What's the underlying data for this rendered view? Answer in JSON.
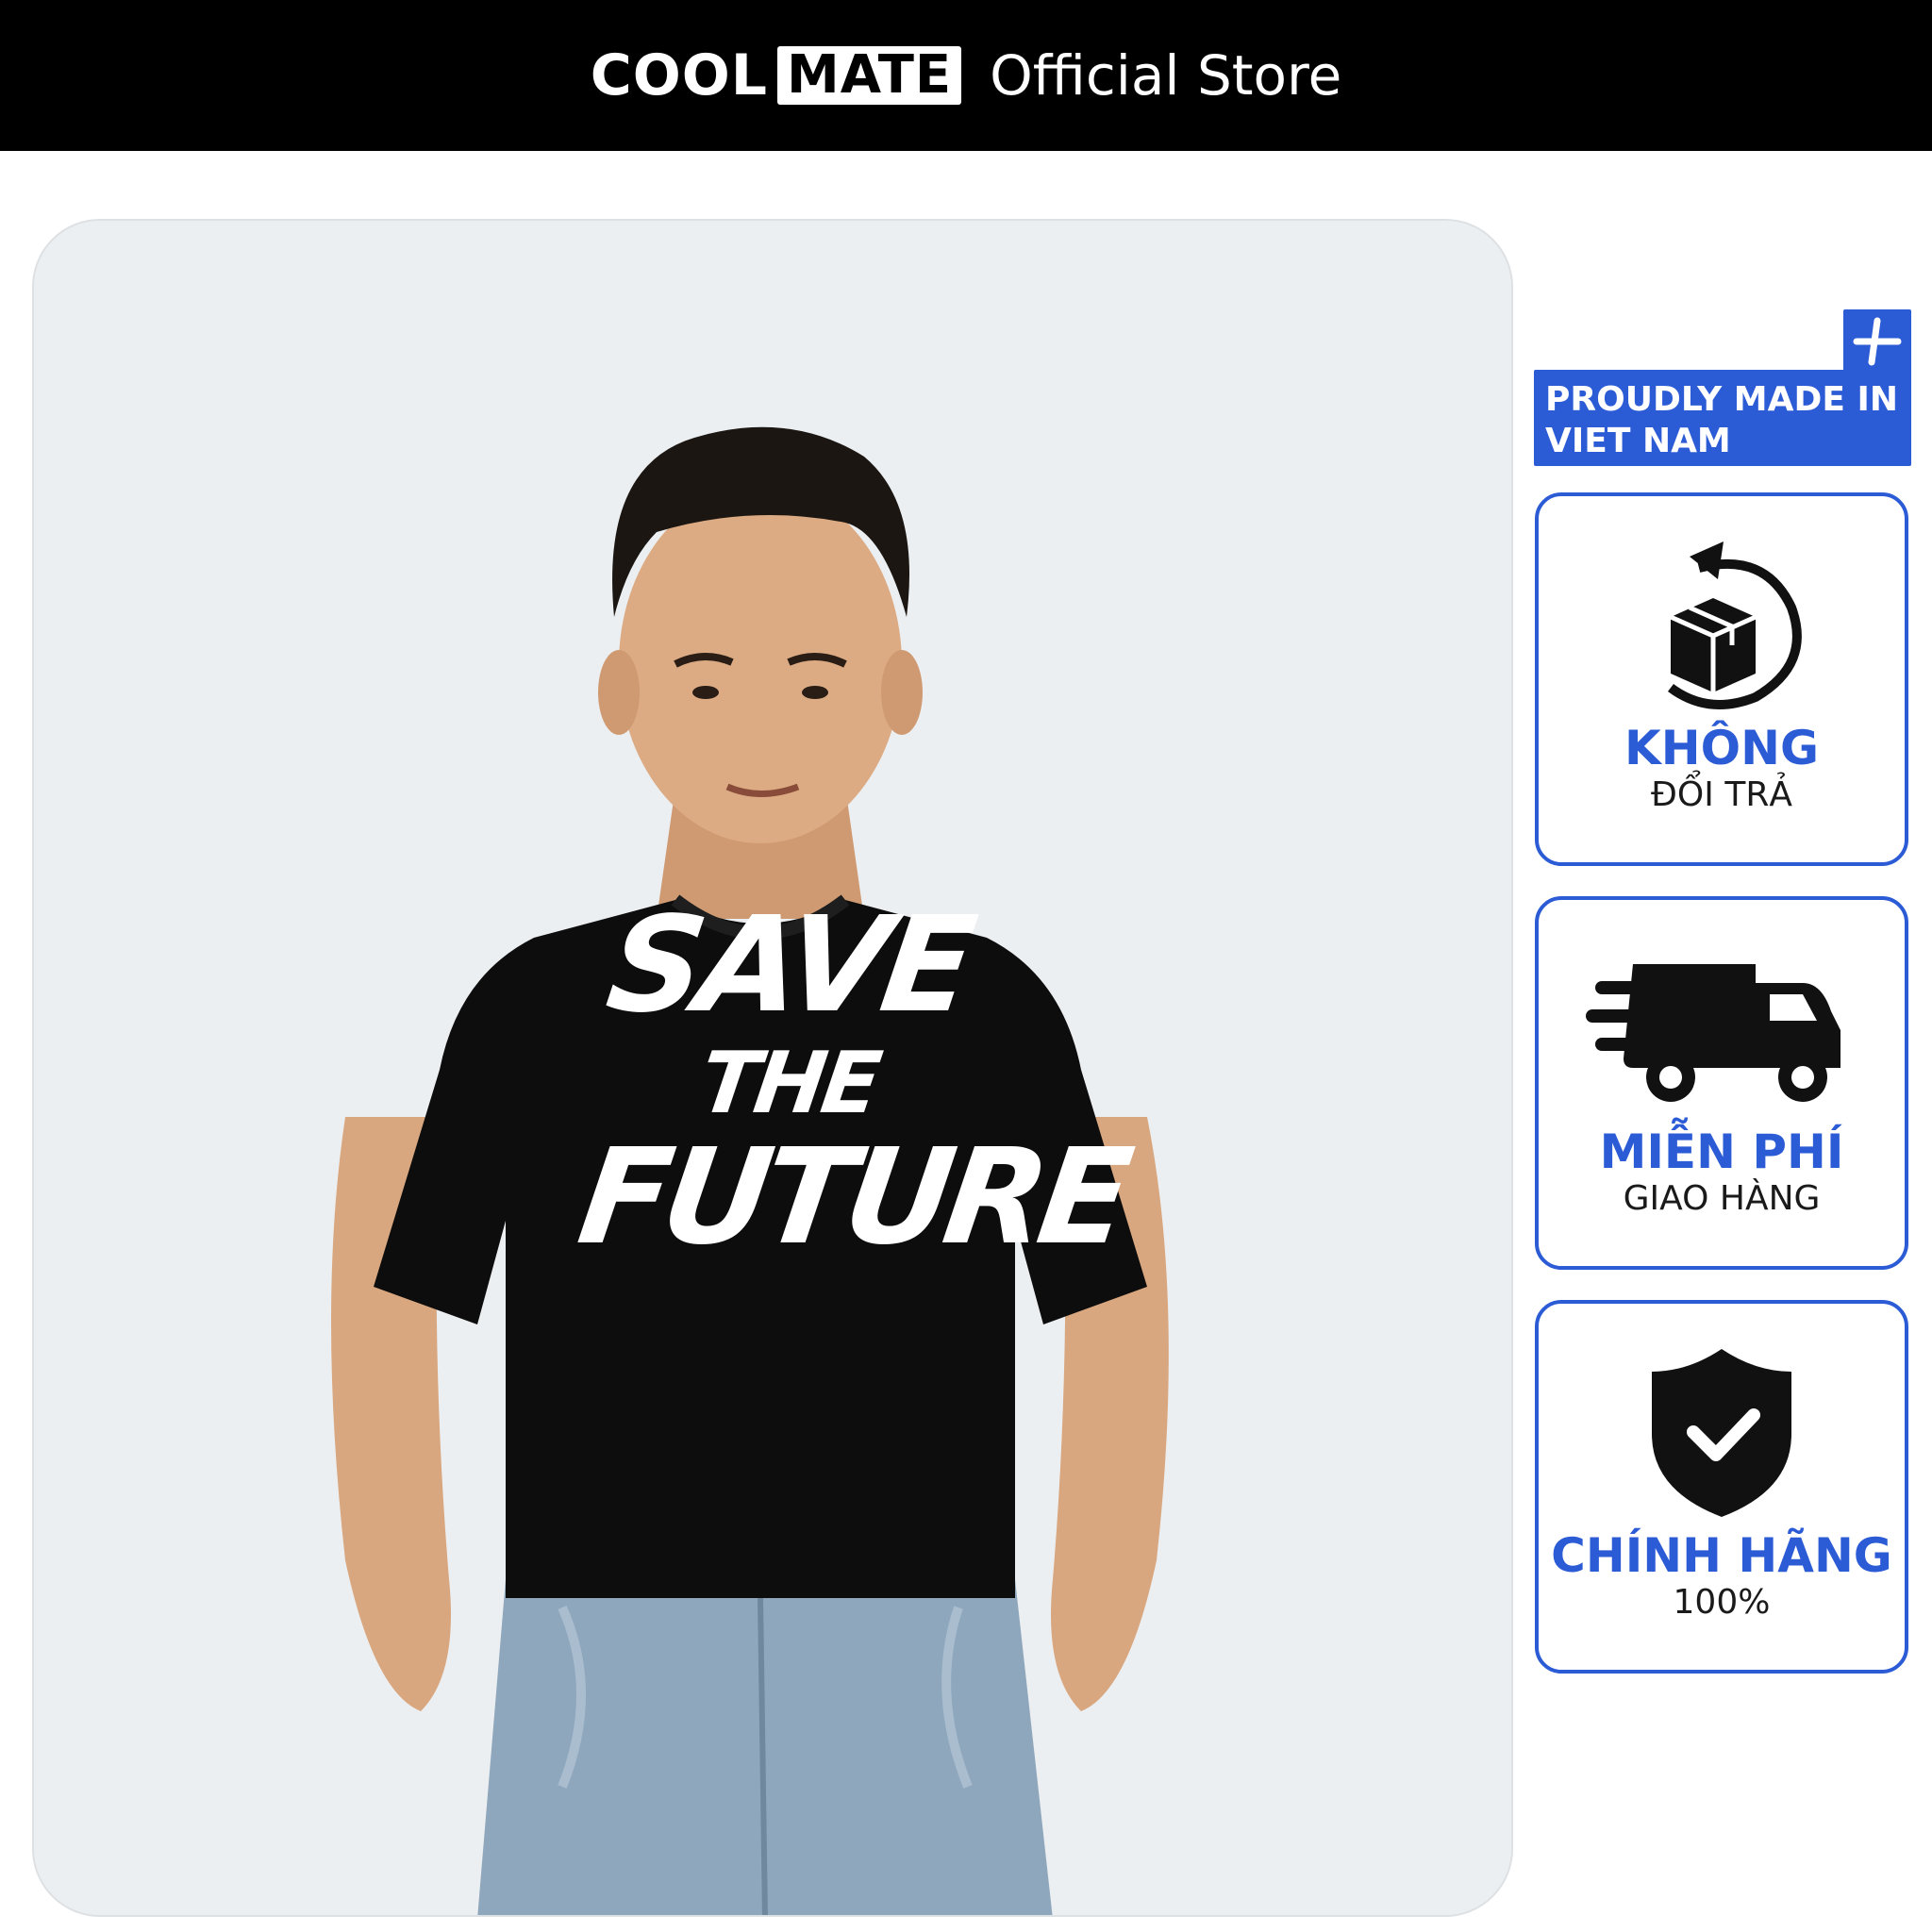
{
  "header": {
    "brand_cool": "COOL",
    "brand_mate": "MATE",
    "store_label": "Official Store"
  },
  "product_image": {
    "print_lines": [
      "SAVE",
      "THE",
      "FUTURE"
    ],
    "shirt_color": "#0d0d0d",
    "background_color": "#eceff1"
  },
  "badges": {
    "made_in": "PROUDLY MADE IN VIET NAM",
    "returns": {
      "title": "KHÔNG",
      "subtitle": "ĐỔI TRẢ",
      "icon": "return-box-icon"
    },
    "shipping": {
      "title": "MIỄN PHÍ",
      "subtitle": "GIAO HÀNG",
      "icon": "delivery-truck-icon"
    },
    "authentic": {
      "title": "CHÍNH HÃNG",
      "subtitle": "100%",
      "icon": "shield-check-icon"
    }
  },
  "colors": {
    "accent": "#2c5bd6",
    "header_bg": "#000000"
  }
}
